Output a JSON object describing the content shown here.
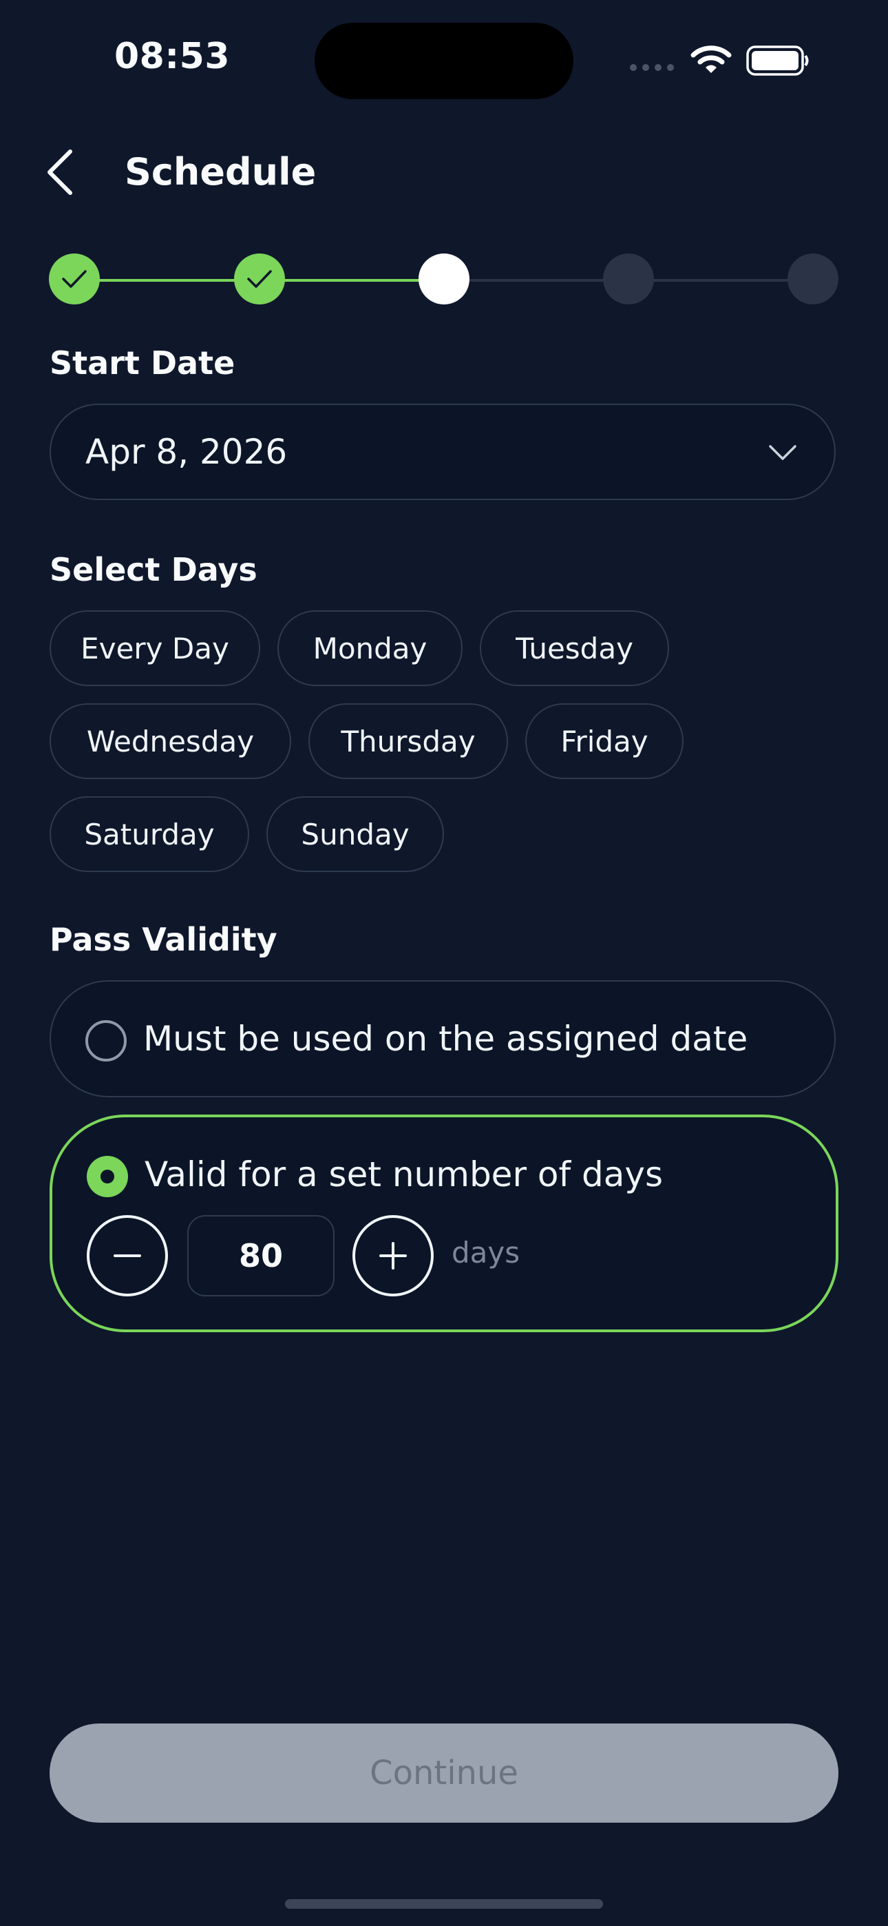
{
  "status_bar": {
    "time": "08:53"
  },
  "header": {
    "title": "Schedule"
  },
  "stepper": {
    "steps": [
      "done",
      "done",
      "current",
      "todo",
      "todo"
    ]
  },
  "start_date": {
    "label": "Start Date",
    "value": "Apr 8, 2026"
  },
  "select_days": {
    "label": "Select Days",
    "chips": [
      "Every Day",
      "Monday",
      "Tuesday",
      "Wednesday",
      "Thursday",
      "Friday",
      "Saturday",
      "Sunday"
    ]
  },
  "pass_validity": {
    "label": "Pass Validity",
    "option_assigned": "Must be used on the assigned date",
    "option_days": "Valid for a set number of days",
    "selected": "days",
    "days_value": "80",
    "days_unit": "days"
  },
  "footer": {
    "continue_label": "Continue"
  },
  "colors": {
    "accent": "#7bd65a",
    "background": "#0f172b",
    "disabled_button": "#9ba3b0"
  }
}
